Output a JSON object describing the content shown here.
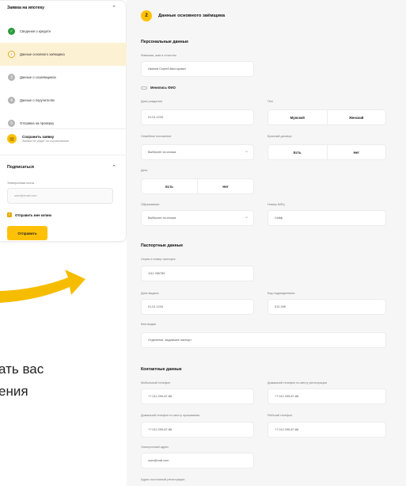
{
  "sidebar": {
    "steps_title": "Заявка на ипотеку",
    "steps": [
      {
        "label": "Сведения о кредите",
        "state": "done",
        "glyph": "✓"
      },
      {
        "label": "Данные основного заёмщика",
        "state": "current",
        "glyph": "2"
      },
      {
        "label": "Данные о созаёмщиках",
        "state": "todo",
        "glyph": "3"
      },
      {
        "label": "Данные о поручителях",
        "state": "todo",
        "glyph": "4"
      },
      {
        "label": "Отправка на проверку",
        "state": "todo",
        "glyph": "5"
      }
    ],
    "save": {
      "title": "Сохранить заявку",
      "subtitle": "Заявка не уйдет на согласование"
    },
    "subscribe": {
      "title": "Подписаться",
      "email_label": "Электронная почта",
      "email_placeholder": "user@email.com",
      "checkbox_label": "Отправить мне копию",
      "button": "Отправить"
    }
  },
  "promo": {
    "line1": "ать вас",
    "line2": "ения"
  },
  "colors": {
    "accent": "#ffc107",
    "done": "#2c9a3c",
    "active_bg": "#fdf1d4"
  },
  "form": {
    "step_number": "2",
    "title": "Данные основного заёмщика",
    "personal": {
      "title": "Персональные данные",
      "fio_label": "Фамилия, имя и отчество",
      "fio_value": "Иванов Сергей Викторович",
      "mfc_label": "Менялись ФИО",
      "birth_label": "Дата рождения",
      "birth_value": "01.01.1234",
      "gender_label": "Пол",
      "gender_options": [
        "Мужской",
        "Женский"
      ],
      "marital_label": "Семейное положение",
      "marital_value": "Выберите из списка",
      "contract_label": "Брачный договор",
      "contract_options": [
        "Есть",
        "Нет"
      ],
      "children_label": "Дети",
      "children_options": [
        "Есть",
        "Нет"
      ],
      "education_label": "Образование",
      "education_value": "Выберите из списка",
      "mfc_number_label": "Номер МФЦ",
      "mfc_number_value": "Сейф"
    },
    "passport": {
      "title": "Паспортные данные",
      "series_label": "Серия и номер паспорта",
      "series_value": "1111 456789",
      "issue_date_label": "Дата выдачи",
      "issue_date_value": "01.01.1234",
      "division_label": "Код подразделения",
      "division_value": "012-345",
      "issued_by_label": "Кем выдан",
      "issued_by_value": "Отделение, выдавшее паспорт"
    },
    "contacts": {
      "title": "Контактные данные",
      "mobile_label": "Мобильный телефон",
      "mobile_value": "+7 012 299-87-88",
      "home_reg_label": "Домашний телефон по месту регистрации",
      "home_reg_value": "+7 012 299-87-88",
      "home_live_label": "Домашний телефон по месту проживания",
      "home_live_value": "+7 012 299-87-88",
      "work_label": "Рабочий телефон",
      "work_value": "+7 012 299-87-88",
      "email_label": "Электронный адрес",
      "email_value": "user@mail.com",
      "address_label": "Адрес постоянной регистрации"
    }
  }
}
